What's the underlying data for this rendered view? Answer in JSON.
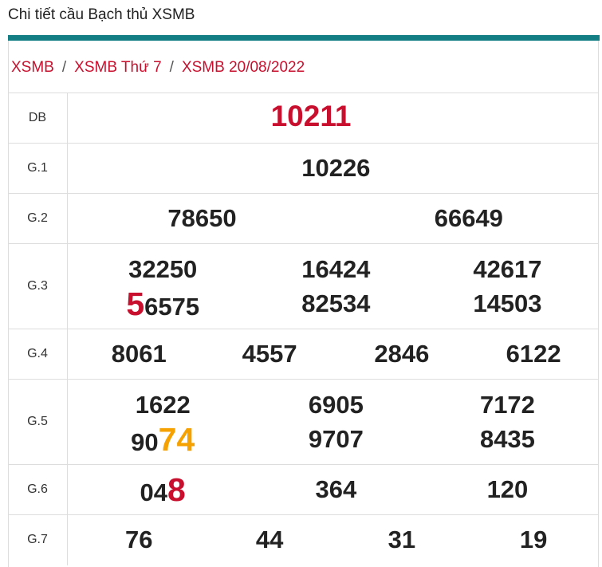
{
  "page_title": "Chi tiết cầu Bạch thủ XSMB",
  "breadcrumb": [
    "XSMB",
    "XSMB Thứ 7",
    "XSMB 20/08/2022"
  ],
  "breadcrumb_sep": "/",
  "colors": {
    "accent_bar": "#137e83",
    "red": "#c8102e",
    "orange": "#f5a100"
  },
  "prizes": {
    "db": {
      "label": "DB",
      "values": [
        "10211"
      ]
    },
    "g1": {
      "label": "G.1",
      "values": [
        "10226"
      ]
    },
    "g2": {
      "label": "G.2",
      "values": [
        "78650",
        "66649"
      ]
    },
    "g3": {
      "label": "G.3",
      "values": [
        "32250",
        "16424",
        "42617",
        "56575",
        "82534",
        "14503"
      ]
    },
    "g4": {
      "label": "G.4",
      "values": [
        "8061",
        "4557",
        "2846",
        "6122"
      ]
    },
    "g5": {
      "label": "G.5",
      "values": [
        "1622",
        "6905",
        "7172",
        "9074",
        "9707",
        "8435"
      ]
    },
    "g6": {
      "label": "G.6",
      "values": [
        "048",
        "364",
        "120"
      ]
    },
    "g7": {
      "label": "G.7",
      "values": [
        "76",
        "44",
        "31",
        "19"
      ]
    }
  },
  "highlights": {
    "g3_5_prefix": "",
    "g3_5_mark": "5",
    "g3_5_rest": "6575",
    "g5_4_prefix": "90",
    "g5_4_mark": "74",
    "g6_1_prefix": "04",
    "g6_1_mark": "8"
  }
}
